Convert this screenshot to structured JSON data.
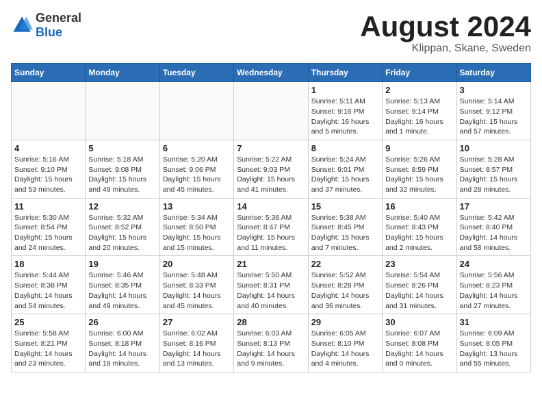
{
  "header": {
    "logo_general": "General",
    "logo_blue": "Blue",
    "month_title": "August 2024",
    "location": "Klippan, Skane, Sweden"
  },
  "days_of_week": [
    "Sunday",
    "Monday",
    "Tuesday",
    "Wednesday",
    "Thursday",
    "Friday",
    "Saturday"
  ],
  "weeks": [
    [
      {
        "day": "",
        "info": ""
      },
      {
        "day": "",
        "info": ""
      },
      {
        "day": "",
        "info": ""
      },
      {
        "day": "",
        "info": ""
      },
      {
        "day": "1",
        "info": "Sunrise: 5:11 AM\nSunset: 9:16 PM\nDaylight: 16 hours\nand 5 minutes."
      },
      {
        "day": "2",
        "info": "Sunrise: 5:13 AM\nSunset: 9:14 PM\nDaylight: 16 hours\nand 1 minute."
      },
      {
        "day": "3",
        "info": "Sunrise: 5:14 AM\nSunset: 9:12 PM\nDaylight: 15 hours\nand 57 minutes."
      }
    ],
    [
      {
        "day": "4",
        "info": "Sunrise: 5:16 AM\nSunset: 9:10 PM\nDaylight: 15 hours\nand 53 minutes."
      },
      {
        "day": "5",
        "info": "Sunrise: 5:18 AM\nSunset: 9:08 PM\nDaylight: 15 hours\nand 49 minutes."
      },
      {
        "day": "6",
        "info": "Sunrise: 5:20 AM\nSunset: 9:06 PM\nDaylight: 15 hours\nand 45 minutes."
      },
      {
        "day": "7",
        "info": "Sunrise: 5:22 AM\nSunset: 9:03 PM\nDaylight: 15 hours\nand 41 minutes."
      },
      {
        "day": "8",
        "info": "Sunrise: 5:24 AM\nSunset: 9:01 PM\nDaylight: 15 hours\nand 37 minutes."
      },
      {
        "day": "9",
        "info": "Sunrise: 5:26 AM\nSunset: 8:59 PM\nDaylight: 15 hours\nand 32 minutes."
      },
      {
        "day": "10",
        "info": "Sunrise: 5:28 AM\nSunset: 8:57 PM\nDaylight: 15 hours\nand 28 minutes."
      }
    ],
    [
      {
        "day": "11",
        "info": "Sunrise: 5:30 AM\nSunset: 8:54 PM\nDaylight: 15 hours\nand 24 minutes."
      },
      {
        "day": "12",
        "info": "Sunrise: 5:32 AM\nSunset: 8:52 PM\nDaylight: 15 hours\nand 20 minutes."
      },
      {
        "day": "13",
        "info": "Sunrise: 5:34 AM\nSunset: 8:50 PM\nDaylight: 15 hours\nand 15 minutes."
      },
      {
        "day": "14",
        "info": "Sunrise: 5:36 AM\nSunset: 8:47 PM\nDaylight: 15 hours\nand 11 minutes."
      },
      {
        "day": "15",
        "info": "Sunrise: 5:38 AM\nSunset: 8:45 PM\nDaylight: 15 hours\nand 7 minutes."
      },
      {
        "day": "16",
        "info": "Sunrise: 5:40 AM\nSunset: 8:43 PM\nDaylight: 15 hours\nand 2 minutes."
      },
      {
        "day": "17",
        "info": "Sunrise: 5:42 AM\nSunset: 8:40 PM\nDaylight: 14 hours\nand 58 minutes."
      }
    ],
    [
      {
        "day": "18",
        "info": "Sunrise: 5:44 AM\nSunset: 8:38 PM\nDaylight: 14 hours\nand 54 minutes."
      },
      {
        "day": "19",
        "info": "Sunrise: 5:46 AM\nSunset: 8:35 PM\nDaylight: 14 hours\nand 49 minutes."
      },
      {
        "day": "20",
        "info": "Sunrise: 5:48 AM\nSunset: 8:33 PM\nDaylight: 14 hours\nand 45 minutes."
      },
      {
        "day": "21",
        "info": "Sunrise: 5:50 AM\nSunset: 8:31 PM\nDaylight: 14 hours\nand 40 minutes."
      },
      {
        "day": "22",
        "info": "Sunrise: 5:52 AM\nSunset: 8:28 PM\nDaylight: 14 hours\nand 36 minutes."
      },
      {
        "day": "23",
        "info": "Sunrise: 5:54 AM\nSunset: 8:26 PM\nDaylight: 14 hours\nand 31 minutes."
      },
      {
        "day": "24",
        "info": "Sunrise: 5:56 AM\nSunset: 8:23 PM\nDaylight: 14 hours\nand 27 minutes."
      }
    ],
    [
      {
        "day": "25",
        "info": "Sunrise: 5:58 AM\nSunset: 8:21 PM\nDaylight: 14 hours\nand 23 minutes."
      },
      {
        "day": "26",
        "info": "Sunrise: 6:00 AM\nSunset: 8:18 PM\nDaylight: 14 hours\nand 18 minutes."
      },
      {
        "day": "27",
        "info": "Sunrise: 6:02 AM\nSunset: 8:16 PM\nDaylight: 14 hours\nand 13 minutes."
      },
      {
        "day": "28",
        "info": "Sunrise: 6:03 AM\nSunset: 8:13 PM\nDaylight: 14 hours\nand 9 minutes."
      },
      {
        "day": "29",
        "info": "Sunrise: 6:05 AM\nSunset: 8:10 PM\nDaylight: 14 hours\nand 4 minutes."
      },
      {
        "day": "30",
        "info": "Sunrise: 6:07 AM\nSunset: 8:08 PM\nDaylight: 14 hours\nand 0 minutes."
      },
      {
        "day": "31",
        "info": "Sunrise: 6:09 AM\nSunset: 8:05 PM\nDaylight: 13 hours\nand 55 minutes."
      }
    ]
  ]
}
